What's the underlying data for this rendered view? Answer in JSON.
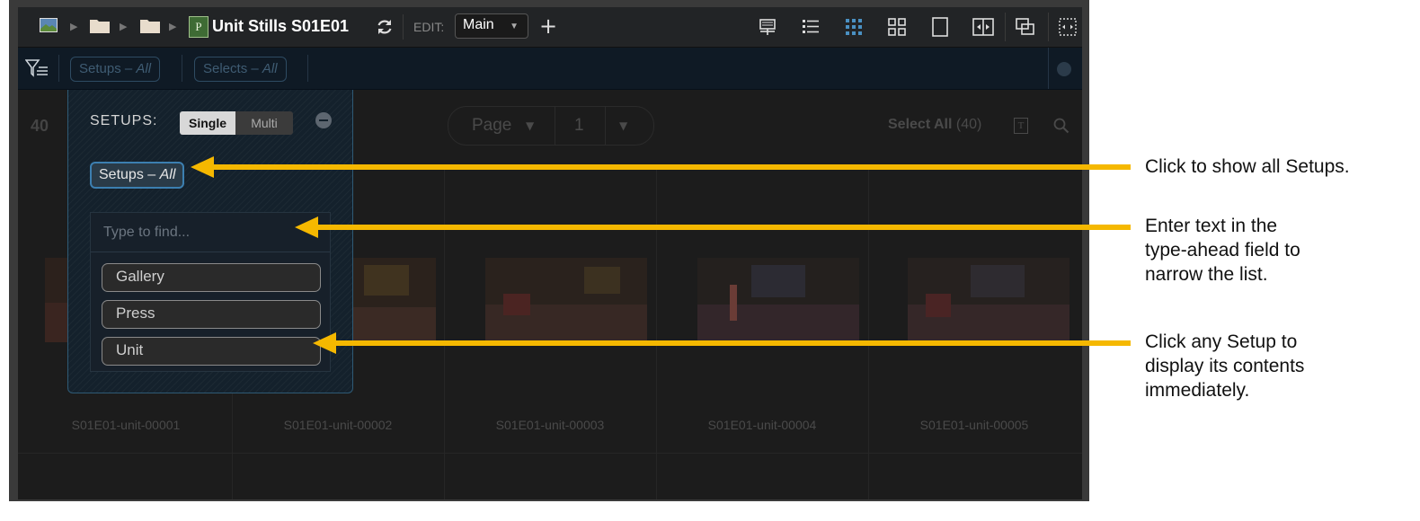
{
  "toolbar": {
    "title": "Unit Stills S01E01",
    "project_badge": "P",
    "edit_label": "EDIT:",
    "edit_value": "Main",
    "add_label": "+"
  },
  "filterbar": {
    "setups_chip_prefix": "Setups – ",
    "setups_chip_value": "All",
    "selects_chip_prefix": "Selects – ",
    "selects_chip_value": "All"
  },
  "content": {
    "count": "40",
    "pager_label": "Page",
    "page_number": "1",
    "select_all_label": "Select All",
    "select_all_count": "(40)",
    "text_toggle": "T",
    "thumbnails": [
      "S01E01-unit-00001",
      "S01E01-unit-00002",
      "S01E01-unit-00003",
      "S01E01-unit-00004",
      "S01E01-unit-00005"
    ]
  },
  "popover": {
    "title": "SETUPS:",
    "mode_single": "Single",
    "mode_multi": "Multi",
    "all_chip_prefix": "Setups – ",
    "all_chip_value": "All",
    "search_placeholder": "Type to find...",
    "options": [
      "Gallery",
      "Press",
      "Unit"
    ]
  },
  "annotations": {
    "note1": "Click to show all Setups.",
    "note2": [
      "Enter text in the",
      "type-ahead field to",
      "narrow the list."
    ],
    "note3": [
      "Click any Setup to",
      "display its contents",
      "immediately."
    ]
  },
  "colors": {
    "accent": "#3c7fb0",
    "arrow": "#f5b800",
    "active_view": "#4a90c2"
  }
}
